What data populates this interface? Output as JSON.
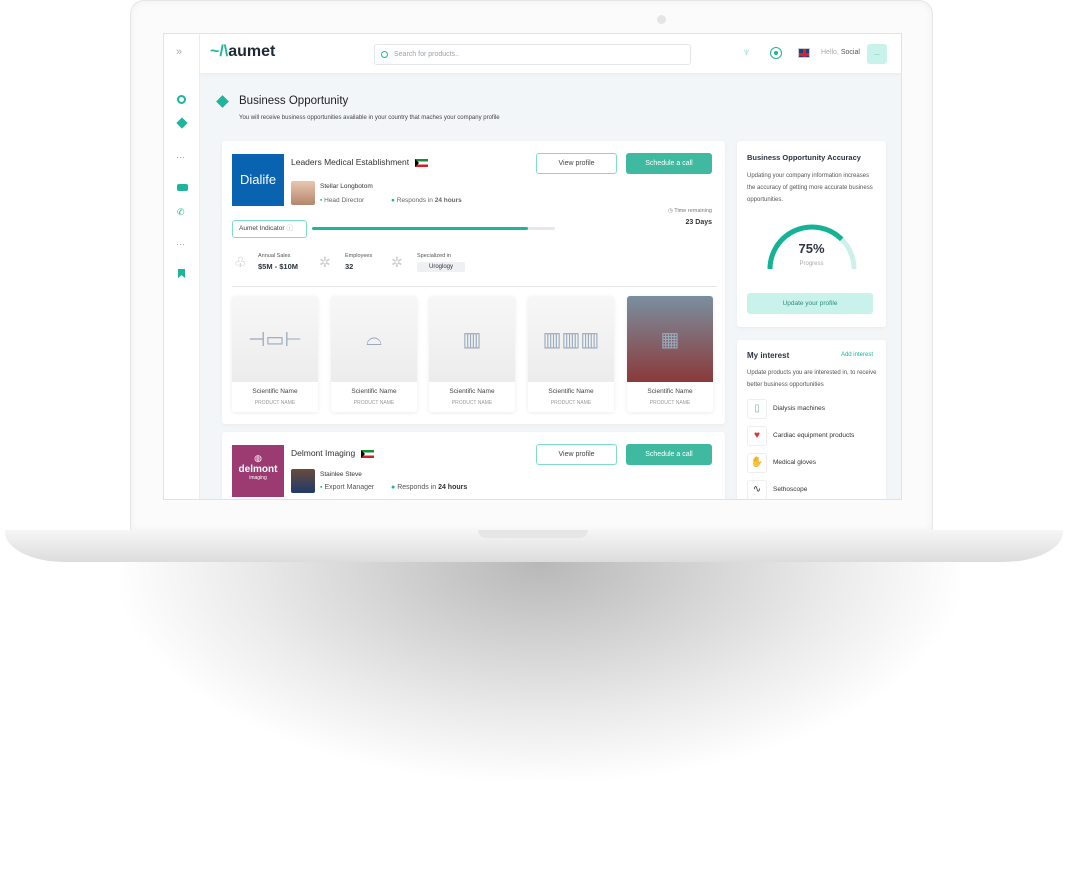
{
  "header": {
    "logo": "aumet",
    "search_placeholder": "Search for products..",
    "greeting": "Hello,",
    "user": "Social",
    "avatar": "..."
  },
  "page": {
    "title": "Business Opportunity",
    "subtitle": "You will receive business opportunities available in your country that maches your company profile"
  },
  "opportunities": [
    {
      "logo": "Dialife",
      "company": "Leaders Medical Establishment",
      "contact": "Stellar Longbotom",
      "role": "Head Director",
      "responds_prefix": "Responds in",
      "responds": "24 hours",
      "view_profile": "View profile",
      "schedule": "Schedule a call",
      "time_label": "Time remaining",
      "time_value": "23 Days",
      "indicator_label": "Aumet Indicator",
      "indicator_percent": 89,
      "stats": {
        "sales_label": "Annual Sales",
        "sales": "$5M - $10M",
        "employees_label": "Employees",
        "employees": "32",
        "specialized_label": "Specialized in",
        "specialized": "Uroglogy"
      },
      "products": [
        {
          "scientific": "Scientific Name",
          "name": "PRODUCT NAME"
        },
        {
          "scientific": "Scientific Name",
          "name": "PRODUCT NAME"
        },
        {
          "scientific": "Scientific Name",
          "name": "PRODUCT NAME"
        },
        {
          "scientific": "Scientific Name",
          "name": "PRODUCT NAME"
        },
        {
          "scientific": "Scientific Name",
          "name": "PRODUCT NAME"
        }
      ]
    },
    {
      "logo": "delmont",
      "logo_sub": "imaging",
      "company": "Delmont Imaging",
      "contact": "Stainlee Steve",
      "role": "Export Manager",
      "responds_prefix": "Responds in",
      "responds": "24 hours",
      "view_profile": "View profile",
      "schedule": "Schedule a call"
    }
  ],
  "accuracy": {
    "title": "Business Opportunity Accuracy",
    "text": "Updating your company information increases the accuracy of getting more accurate business opportunities.",
    "percent_label": "75%",
    "percent": 75,
    "progress_label": "Progress",
    "button": "Update your profile"
  },
  "interest": {
    "title": "My interest",
    "add": "Add interest",
    "text": "Update products you are interested in, to receive better business opportunities",
    "items": [
      "Dialysis machines",
      "Cardiac equipment products",
      "Medical gloves",
      "Sethoscope"
    ]
  },
  "colors": {
    "accent": "#1fb59c",
    "button": "#3fb99f",
    "delmont": "#9c3b72",
    "dialife": "#0a63b0"
  }
}
